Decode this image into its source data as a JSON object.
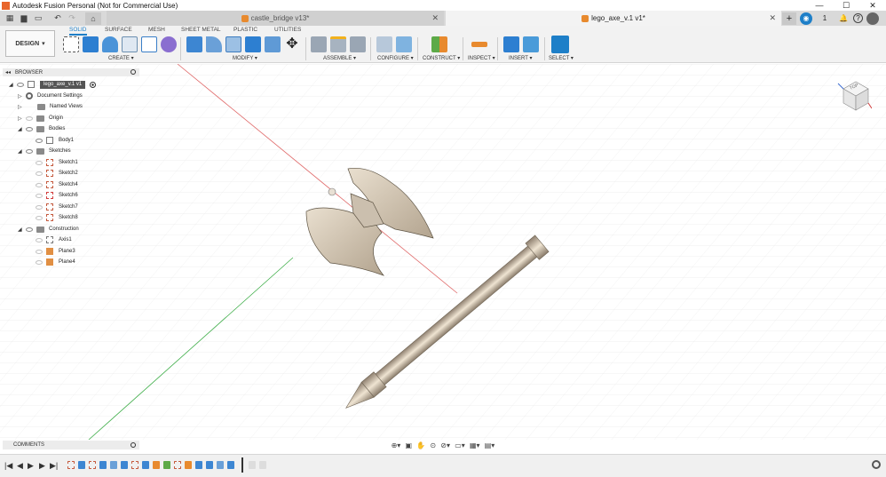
{
  "app": {
    "title": "Autodesk Fusion Personal (Not for Commercial Use)"
  },
  "window_controls": {
    "minimize": "—",
    "maximize": "☐",
    "close": "✕"
  },
  "quick_access": {
    "grid": "▦",
    "file": "▆",
    "save": "▭",
    "undo": "↶",
    "redo": "↷",
    "home": "⌂"
  },
  "tabs": [
    {
      "label": "castle_bridge v13*",
      "active": false,
      "close": "✕"
    },
    {
      "label": "lego_axe_v.1 v1*",
      "active": true,
      "close": "✕"
    }
  ],
  "header_right": {
    "add": "+",
    "online": "◉",
    "jobs": "1",
    "help": "?"
  },
  "ribbon": {
    "design_label": "DESIGN",
    "mode_tabs": [
      "SOLID",
      "SURFACE",
      "MESH",
      "SHEET METAL",
      "PLASTIC",
      "UTILITIES"
    ],
    "groups": [
      "CREATE",
      "MODIFY",
      "ASSEMBLE",
      "CONFIGURE",
      "CONSTRUCT",
      "INSPECT",
      "INSERT",
      "SELECT"
    ]
  },
  "browser": {
    "title": "BROWSER",
    "collapse": "◂◂",
    "root": "lego_axe_v.1 v1",
    "items": [
      {
        "label": "Document Settings",
        "type": "settings"
      },
      {
        "label": "Named Views",
        "type": "folder"
      },
      {
        "label": "Origin",
        "type": "folder"
      },
      {
        "label": "Bodies",
        "type": "folder"
      },
      {
        "label": "Body1",
        "type": "body"
      },
      {
        "label": "Sketches",
        "type": "folder"
      },
      {
        "label": "Sketch1",
        "type": "sketch"
      },
      {
        "label": "Sketch2",
        "type": "sketch"
      },
      {
        "label": "Sketch4",
        "type": "sketch"
      },
      {
        "label": "Sketch6",
        "type": "sketch"
      },
      {
        "label": "Sketch7",
        "type": "sketch"
      },
      {
        "label": "Sketch8",
        "type": "sketch"
      },
      {
        "label": "Construction",
        "type": "folder"
      },
      {
        "label": "Axis1",
        "type": "axis"
      },
      {
        "label": "Plane3",
        "type": "plane"
      },
      {
        "label": "Plane4",
        "type": "plane"
      }
    ]
  },
  "comments": {
    "title": "COMMENTS"
  },
  "viewcube": {
    "face": "TOP"
  },
  "timeline": {
    "first": "|◀",
    "prev": "◀",
    "play": "▶",
    "next": "▶",
    "last": "▶|"
  },
  "colors": {
    "accent": "#1e7fc8",
    "brand": "#e8662c",
    "model": "#d4c5ab"
  }
}
